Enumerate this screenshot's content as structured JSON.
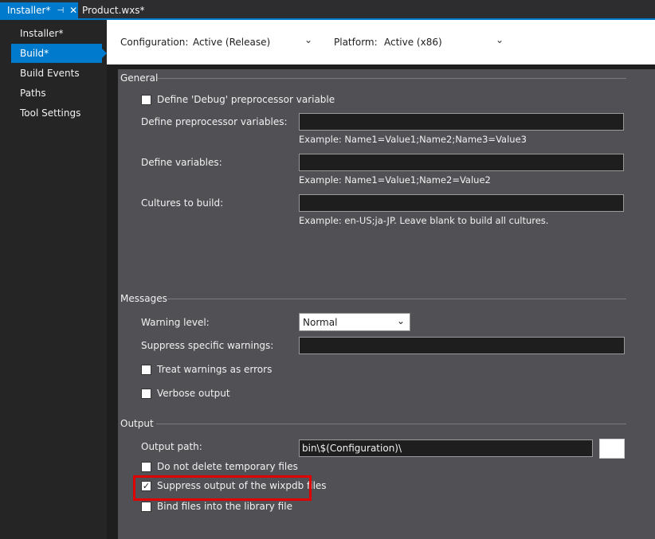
{
  "tabs": {
    "active_label": "Installer*",
    "active_pin": "⊣",
    "active_close": "✕",
    "inactive_label": "Product.wxs*"
  },
  "nav": {
    "items": [
      {
        "label": "Installer*"
      },
      {
        "label": "Build*"
      },
      {
        "label": "Build Events"
      },
      {
        "label": "Paths"
      },
      {
        "label": "Tool Settings"
      }
    ],
    "selected_index": 1
  },
  "config": {
    "configuration_label": "Configuration:",
    "configuration_value": "Active (Release)",
    "platform_label": "Platform:",
    "platform_value": "Active (x86)"
  },
  "general": {
    "header": "General",
    "define_debug_label": "Define 'Debug' preprocessor variable",
    "define_debug_checked": false,
    "preprocessor_label": "Define preprocessor variables:",
    "preprocessor_value": "",
    "preprocessor_hint": "Example: Name1=Value1;Name2;Name3=Value3",
    "variables_label": "Define variables:",
    "variables_value": "",
    "variables_hint": "Example: Name1=Value1;Name2=Value2",
    "cultures_label": "Cultures to build:",
    "cultures_value": "",
    "cultures_hint": "Example: en-US;ja-JP. Leave blank to build all cultures."
  },
  "messages": {
    "header": "Messages",
    "warning_level_label": "Warning level:",
    "warning_level_value": "Normal",
    "suppress_warnings_label": "Suppress specific warnings:",
    "suppress_warnings_value": "",
    "treat_warnings_label": "Treat warnings as errors",
    "treat_warnings_checked": false,
    "verbose_label": "Verbose output",
    "verbose_checked": false
  },
  "output": {
    "header": "Output",
    "output_path_label": "Output path:",
    "output_path_value": "bin\\$(Configuration)\\",
    "no_delete_label": "Do not delete temporary files",
    "no_delete_checked": false,
    "suppress_wixpdb_label": "Suppress output of the wixpdb files",
    "suppress_wixpdb_checked": true,
    "bind_files_label": "Bind files into the library file",
    "bind_files_checked": false
  },
  "colors": {
    "accent": "#007acc",
    "panel_bg": "#515155",
    "highlight": "#e00000"
  }
}
